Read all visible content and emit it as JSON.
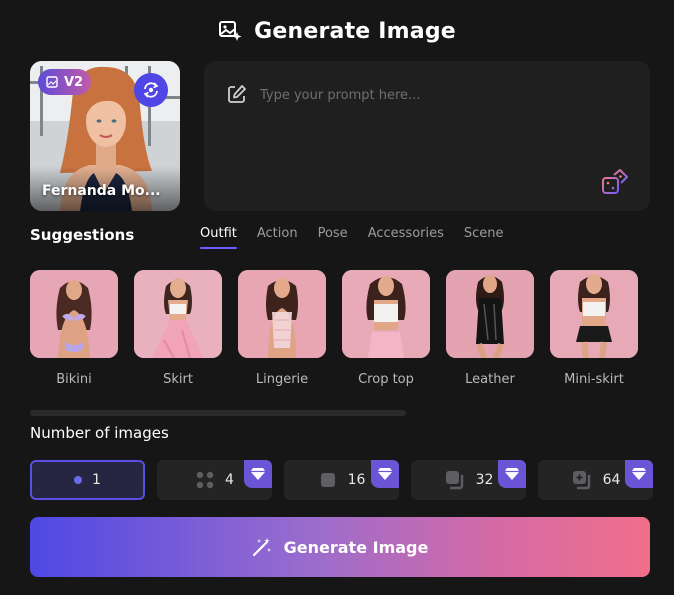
{
  "header": {
    "title": "Generate Image",
    "icon": "image-sparkle-icon"
  },
  "avatar": {
    "name": "Fernanda Mo...",
    "version_badge": "V2"
  },
  "prompt": {
    "placeholder": "Type your prompt here...",
    "value": ""
  },
  "suggestions": {
    "title": "Suggestions",
    "tabs": [
      {
        "label": "Outfit",
        "active": true
      },
      {
        "label": "Action",
        "active": false
      },
      {
        "label": "Pose",
        "active": false
      },
      {
        "label": "Accessories",
        "active": false
      },
      {
        "label": "Scene",
        "active": false
      }
    ],
    "items": [
      {
        "label": "Bikini"
      },
      {
        "label": "Skirt"
      },
      {
        "label": "Lingerie"
      },
      {
        "label": "Crop top"
      },
      {
        "label": "Leather"
      },
      {
        "label": "Mini-skirt"
      }
    ]
  },
  "number_of_images": {
    "title": "Number of images",
    "options": [
      {
        "value": "1",
        "selected": true,
        "premium": false
      },
      {
        "value": "4",
        "selected": false,
        "premium": true
      },
      {
        "value": "16",
        "selected": false,
        "premium": true
      },
      {
        "value": "32",
        "selected": false,
        "premium": true
      },
      {
        "value": "64",
        "selected": false,
        "premium": true
      }
    ]
  },
  "generate_button": {
    "label": "Generate Image",
    "icon": "magic-wand-icon"
  },
  "colors": {
    "background": "#161616",
    "panel": "#1f1f1f",
    "accent": "#5850e6",
    "premium": "#6b55d6",
    "gradient_start": "#4e48e4",
    "gradient_end": "#f06f8a"
  }
}
